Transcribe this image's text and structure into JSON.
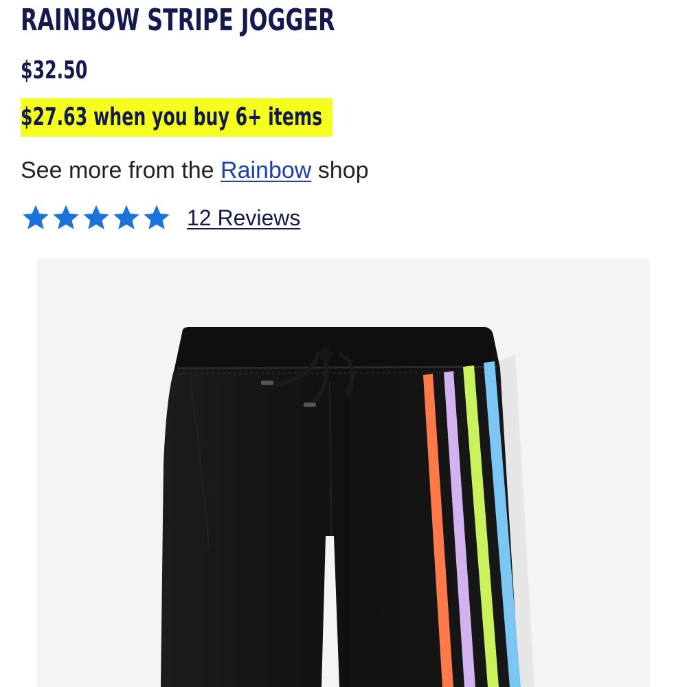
{
  "product": {
    "title": "RAINBOW STRIPE JOGGER",
    "price": "$32.50",
    "promo_price": "$27.63 when you buy 6+ items",
    "shop_prefix": "See more from the ",
    "shop_link_label": "Rainbow",
    "shop_suffix": " shop",
    "rating_stars": 5,
    "rating_max": 5,
    "reviews_label": "12 Reviews",
    "image_alt": "Black jogger pants with rainbow side stripes"
  },
  "colors": {
    "title_navy": "#141a4b",
    "promo_highlight": "#f4ff1f",
    "star_blue": "#1a73d9",
    "link_blue": "#1d3fb5",
    "image_bg": "#f4f4f4",
    "garment_black": "#121212",
    "stripe_orange": "#ff7a4a",
    "stripe_lilac": "#d3b3ef",
    "stripe_lime": "#c9f25c",
    "stripe_blue": "#7cc6f4"
  },
  "icons": {
    "star": "star-icon"
  }
}
